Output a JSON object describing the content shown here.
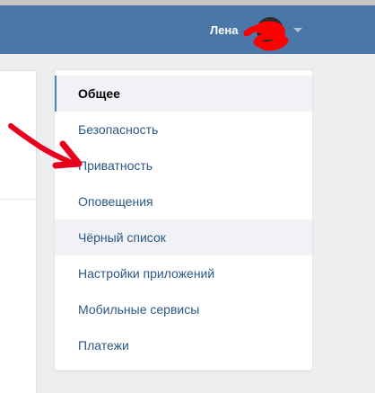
{
  "header": {
    "user_name": "Лена",
    "icons": {
      "avatar": "avatar",
      "dropdown": "chevron-down-icon"
    }
  },
  "settings_menu": {
    "items": [
      {
        "label": "Общее",
        "state": "active"
      },
      {
        "label": "Безопасность",
        "state": "normal"
      },
      {
        "label": "Приватность",
        "state": "normal"
      },
      {
        "label": "Оповещения",
        "state": "normal"
      },
      {
        "label": "Чёрный список",
        "state": "hover"
      },
      {
        "label": "Настройки приложений",
        "state": "normal"
      },
      {
        "label": "Мобильные сервисы",
        "state": "normal"
      },
      {
        "label": "Платежи",
        "state": "normal"
      }
    ]
  },
  "annotations": {
    "arrow": {
      "color": "#e8001c",
      "points_to": "Приватность"
    },
    "scribble": {
      "color": "#ff0000",
      "covers": "avatar"
    }
  },
  "colors": {
    "header_bg": "#4a76a8",
    "page_bg": "#edeef0",
    "link": "#2a5885",
    "active_bar": "#5181b8"
  }
}
